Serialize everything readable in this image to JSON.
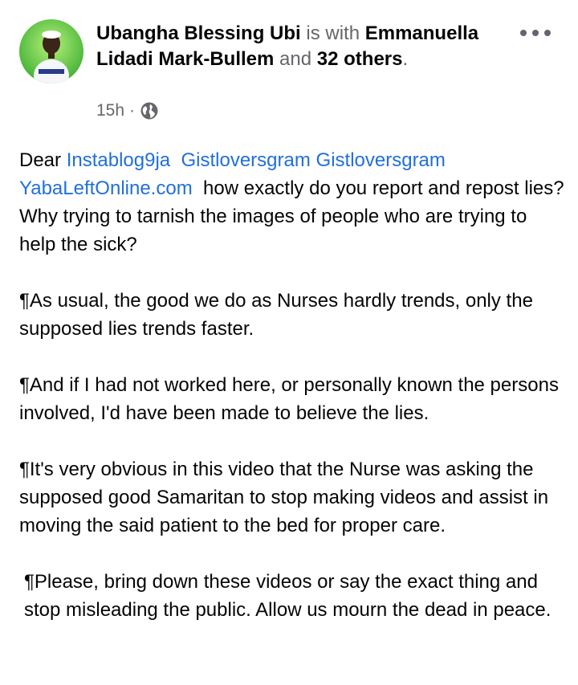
{
  "post": {
    "author": "Ubangha Blessing Ubi",
    "is_with_text": "is with",
    "tagged_person": "Emmanuella Lidadi Mark-Bullem",
    "and_text": "and",
    "others_text": "32 others",
    "period": ".",
    "time": "15h",
    "separator": "·",
    "privacy_icon": "globe-icon",
    "more_icon": "more-options-icon"
  },
  "content": {
    "dear": "Dear",
    "links": [
      "Instablog9ja",
      "Gistloversgram",
      "Gistloversgram",
      "YabaLeftOnline.com"
    ],
    "p1_rest": "how exactly do you report and repost lies? Why trying to tarnish the images of people who are trying to help the sick?",
    "p2": "¶As usual, the good we do as Nurses hardly trends, only the supposed lies trends faster.",
    "p3": "¶And if I had not worked here, or personally known the persons involved, I'd have been made to believe the lies.",
    "p4": "¶It's very obvious in this video that the Nurse was asking the supposed good Samaritan to stop making videos and assist in moving the said patient to the bed for proper care.",
    "p5": "¶Please, bring down these videos or say the exact thing and stop misleading the public. Allow us mourn the dead in peace."
  },
  "colors": {
    "link": "#216fdb",
    "muted": "#65676b",
    "text": "#050505"
  }
}
